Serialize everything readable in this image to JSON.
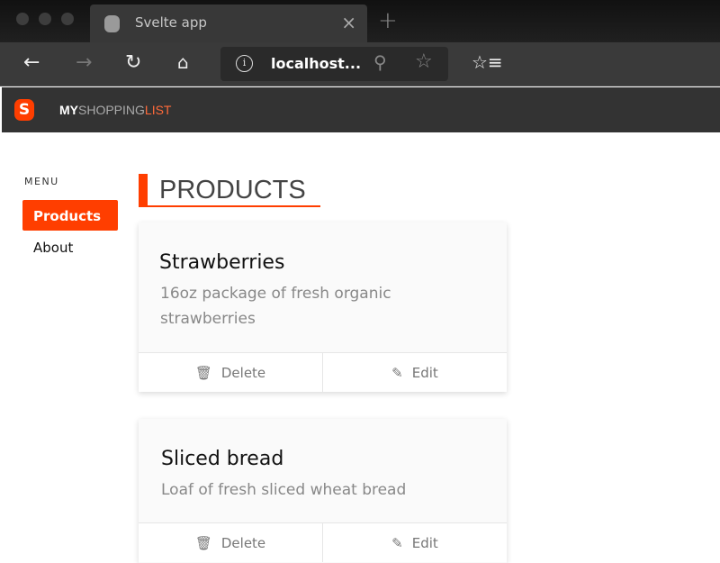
{
  "browser": {
    "tab_title": "Svelte app",
    "url": "localhost...",
    "icons": [
      "back-arrow-icon",
      "forward-arrow-icon",
      "refresh-icon",
      "home-icon",
      "info-icon",
      "zoom-out-icon",
      "add-favorite-icon",
      "favorites-icon"
    ]
  },
  "app": {
    "brand_my": "MY",
    "brand_shopping": "SHOPPING",
    "brand_list": "LIST",
    "accent": "#ff3e00"
  },
  "menu": {
    "heading": "MENU",
    "items": [
      {
        "label": "Products",
        "active": true
      },
      {
        "label": "About",
        "active": false
      }
    ]
  },
  "page": {
    "title": "PRODUCTS"
  },
  "products": [
    {
      "name": "Strawberries",
      "description": "16oz package of fresh organic strawberries",
      "delete_label": "Delete",
      "edit_label": "Edit"
    },
    {
      "name": "Sliced bread",
      "description": "Loaf of fresh sliced wheat bread",
      "delete_label": "Delete",
      "edit_label": "Edit"
    }
  ]
}
